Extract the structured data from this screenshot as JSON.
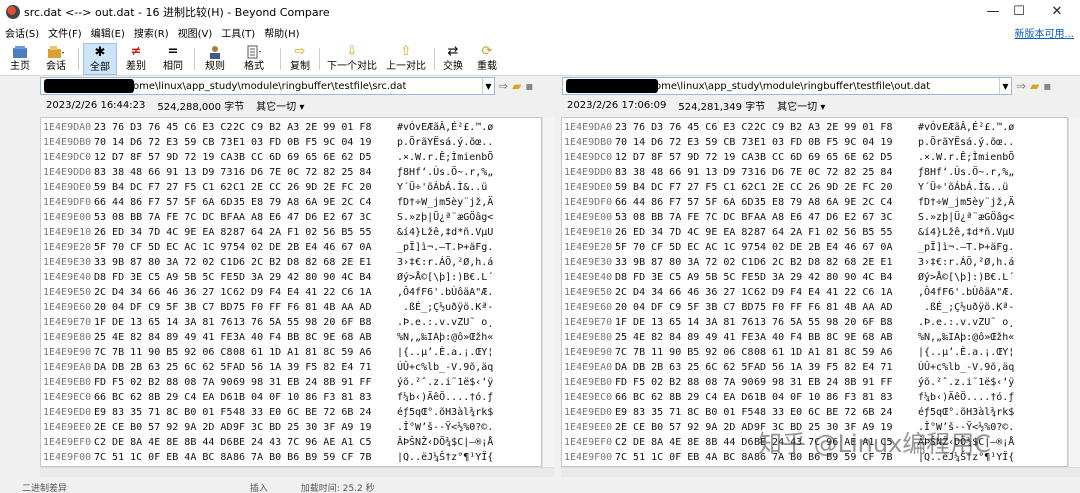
{
  "window": {
    "title": "src.dat <--> out.dat - 16 进制比较(H) - Beyond Compare",
    "minimize": "—",
    "maximize": "☐",
    "close": "✕"
  },
  "menu": {
    "items": [
      "会话(S)",
      "文件(F)",
      "编辑(E)",
      "搜索(R)",
      "视图(V)",
      "工具(T)",
      "帮助(H)"
    ],
    "new_version_link": "新版本可用..."
  },
  "toolbar": {
    "home": "主页",
    "session": "会话",
    "all": "全部",
    "diff": "差别",
    "same": "相同",
    "rules": "规则",
    "format": "格式",
    "copy": "复制",
    "next_diff": "下一个对比",
    "prev_diff": "上一对比",
    "swap": "交换",
    "reload": "重载"
  },
  "left": {
    "path": "ome\\linux\\app_study\\module\\ringbuffer\\testfile\\src.dat",
    "timestamp": "2023/2/26 16:44:23",
    "size": "524,288,000 字节",
    "filter": "其它一切 ▾",
    "rows": [
      {
        "off": "1E4E9DA0",
        "b1": "23 76 D3 76 45 C6 E3 C2",
        "b2": "2C C9 B2 A3 2E 99 01 F8",
        "asc": "#vÓvEÆãÂ,É²£.™.ø"
      },
      {
        "off": "1E4E9DB0",
        "b1": "70 14 D6 72 E3 59 CB 73",
        "b2": "E1 03 FD 0B F5 9C 04 19",
        "asc": "p.ÖrãYËsá.ý.õœ.."
      },
      {
        "off": "1E4E9DC0",
        "b1": "12 D7 8F 57 9D 72 19 CA",
        "b2": "3B CC 6D 69 65 6E 62 D5",
        "asc": ".×.W.r.Ê;ÌmienbÕ"
      },
      {
        "off": "1E4E9DD0",
        "b1": "83 38 48 66 91 13 D9 73",
        "b2": "16 D6 7E 0C 72 82 25 84",
        "asc": "ƒ8Hf‘.Ùs.Ö~.r‚%„"
      },
      {
        "off": "1E4E9DE0",
        "b1": "59 B4 DC F7 27 F5 C1 62",
        "b2": "C1 2E CC 26 9D 2E FC 20",
        "asc": "Y´Ü÷'õÁbÁ.Ì&..ü "
      },
      {
        "off": "1E4E9DF0",
        "b1": "66 44 86 F7 57 5F 6A 6D",
        "b2": "35 E8 79 A8 6A 9E 2C C4",
        "asc": "fD†÷W_jm5èy¨jž,Ä"
      },
      {
        "off": "1E4E9E00",
        "b1": "53 08 BB 7A FE 7C DC BF",
        "b2": "AA A8 E6 47 D6 E2 67 3C",
        "asc": "S.»zþ|Ü¿ª¨æGÖâg<"
      },
      {
        "off": "1E4E9E10",
        "b1": "26 ED 34 7D 4C 9E EA 82",
        "b2": "87 64 2A F1 02 56 B5 55",
        "asc": "&í4}Lžê‚‡d*ñ.VµU"
      },
      {
        "off": "1E4E9E20",
        "b1": "5F 70 CF 5D EC AC 1C 97",
        "b2": "54 02 DE 2B E4 46 67 0A",
        "asc": "_pÏ]ì¬.—T.Þ+äFg."
      },
      {
        "off": "1E4E9E30",
        "b1": "33 9B 87 80 3A 72 02 C1",
        "b2": "D6 2C B2 D8 82 68 2E E1",
        "asc": "3›‡€:r.ÁÖ,²Ø‚h.á"
      },
      {
        "off": "1E4E9E40",
        "b1": "D8 FD 3E C5 A9 5B 5C FE",
        "b2": "5D 3A 29 42 80 90 4C B4",
        "asc": "Øý>Å©[\\þ]:)B€.L´"
      },
      {
        "off": "1E4E9E50",
        "b1": "2C D4 34 66 46 36 27 1C",
        "b2": "62 D9 F4 E4 41 22 C6 1A",
        "asc": ",Ô4fF6'.bÙôäA\"Æ."
      },
      {
        "off": "1E4E9E60",
        "b1": "20 04 DF C9 5F 3B C7 BD",
        "b2": "75 F0 FF F6 81 4B AA AD",
        "asc": " .ßÉ_;Ç½uðÿö.Kª-"
      },
      {
        "off": "1E4E9E70",
        "b1": "1F DE 13 65 14 3A 81 76",
        "b2": "13 76 5A 55 98 20 6F B8",
        "asc": ".Þ.e.:.v.vZU˜ o¸"
      },
      {
        "off": "1E4E9E80",
        "b1": "25 4E 82 84 89 49 41 FE",
        "b2": "3A 40 F4 BB 8C 9E 68 AB",
        "asc": "%N‚„‰IAþ:@ô»Œžh«"
      },
      {
        "off": "1E4E9E90",
        "b1": "7C 7B 11 90 B5 92 06 C8",
        "b2": "08 61 1D A1 81 8C 59 A6",
        "asc": "|{..µ’.È.a.¡.ŒY¦"
      },
      {
        "off": "1E4E9EA0",
        "b1": "DA DB 2B 63 25 6C 62 5F",
        "b2": "AD 56 1A 39 F5 82 E4 71",
        "asc": "ÚÛ+c%lb_-V.9õ‚äq"
      },
      {
        "off": "1E4E9EB0",
        "b1": "FD F5 02 B2 88 08 7A 90",
        "b2": "69 98 31 EB 24 8B 91 FF",
        "asc": "ýõ.²ˆ.z.i˜1ë$‹‘ÿ"
      },
      {
        "off": "1E4E9EC0",
        "b1": "66 BC 62 8B 29 C4 EA D6",
        "b2": "1B 04 0F 10 86 F3 81 83",
        "asc": "f¼b‹)ÄêÖ....†ó.ƒ"
      },
      {
        "off": "1E4E9ED0",
        "b1": "E9 83 35 71 8C B0 01 F5",
        "b2": "48 33 E0 6C BE 72 6B 24",
        "asc": "éƒ5qŒ°.õH3àl¾rk$"
      },
      {
        "off": "1E4E9EE0",
        "b1": "2E CE B0 57 92 9A 2D AD",
        "b2": "9F 3C BD 25 30 3F A9 19",
        "asc": ".Î°W’š--Ÿ<½%0?©."
      },
      {
        "off": "1E4E9EF0",
        "b1": "C2 DE 8A 4E 8E 8B 44 D6",
        "b2": "BE 24 43 7C 96 AE A1 C5",
        "asc": "ÂÞŠNŽ‹DÖ¾$C|–®¡Å"
      },
      {
        "off": "1E4E9F00",
        "b1": "7C 51 1C 0F EB 4A BC 8A",
        "b2": "86 7A B0 B6 B9 59 CF 7B",
        "asc": "|Q..ëJ¼Š†z°¶¹YÏ{"
      }
    ]
  },
  "right": {
    "path": "ome\\linux\\app_study\\module\\ringbuffer\\testfile\\out.dat",
    "timestamp": "2023/2/26 17:06:09",
    "size": "524,281,349 字节",
    "filter": "其它一切 ▾"
  },
  "status": {
    "left": "二进制差异",
    "mid1": "插入",
    "mid2": "加载时间: 25.2 秒"
  },
  "watermark": "知乎 @Linux编程用C"
}
